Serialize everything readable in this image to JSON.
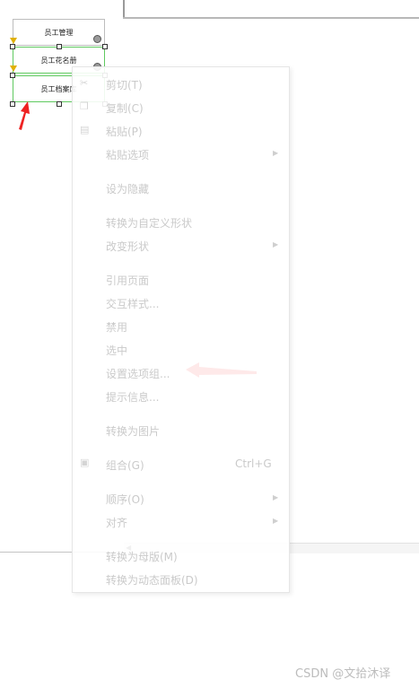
{
  "widgets": [
    {
      "label": "员工管理"
    },
    {
      "label": "员工花名册"
    },
    {
      "label": "员工档案库"
    }
  ],
  "context_menu": {
    "items": [
      {
        "label": "剪切(T)"
      },
      {
        "label": "复制(C)"
      },
      {
        "label": "粘贴(P)"
      },
      {
        "label": "粘贴选项"
      },
      {
        "label": "设为隐藏"
      },
      {
        "label": "转换为自定义形状"
      },
      {
        "label": "改变形状"
      },
      {
        "label": "引用页面"
      },
      {
        "label": "交互样式..."
      },
      {
        "label": "禁用"
      },
      {
        "label": "选中"
      },
      {
        "label": "设置选项组..."
      },
      {
        "label": "提示信息..."
      },
      {
        "label": "转换为图片"
      },
      {
        "label": "组合(G)",
        "shortcut": "Ctrl+G"
      },
      {
        "label": "顺序(O)"
      },
      {
        "label": "对齐"
      },
      {
        "label": "转换为母版(M)"
      },
      {
        "label": "转换为动态面板(D)"
      }
    ]
  },
  "watermark": "CSDN @文拾沐译",
  "colors": {
    "arrow": "#ee2222",
    "selection": "#5fc95f",
    "disabled_text": "#cacaca"
  }
}
